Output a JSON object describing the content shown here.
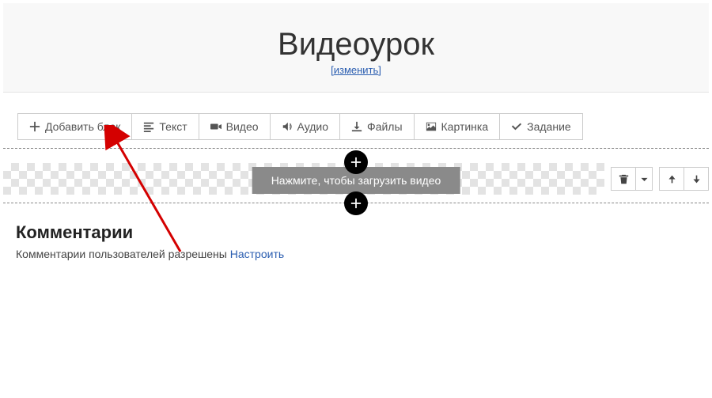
{
  "header": {
    "title": "Видеоурок",
    "change_label": "изменить"
  },
  "toolbar": {
    "add_block": "Добавить блок",
    "text": "Текст",
    "video": "Видео",
    "audio": "Аудио",
    "files": "Файлы",
    "image": "Картинка",
    "task": "Задание"
  },
  "upload": {
    "placeholder": "Нажмите, чтобы загрузить видео"
  },
  "comments": {
    "heading": "Комментарии",
    "status": "Комментарии пользователей разрешены ",
    "configure": "Настроить"
  }
}
